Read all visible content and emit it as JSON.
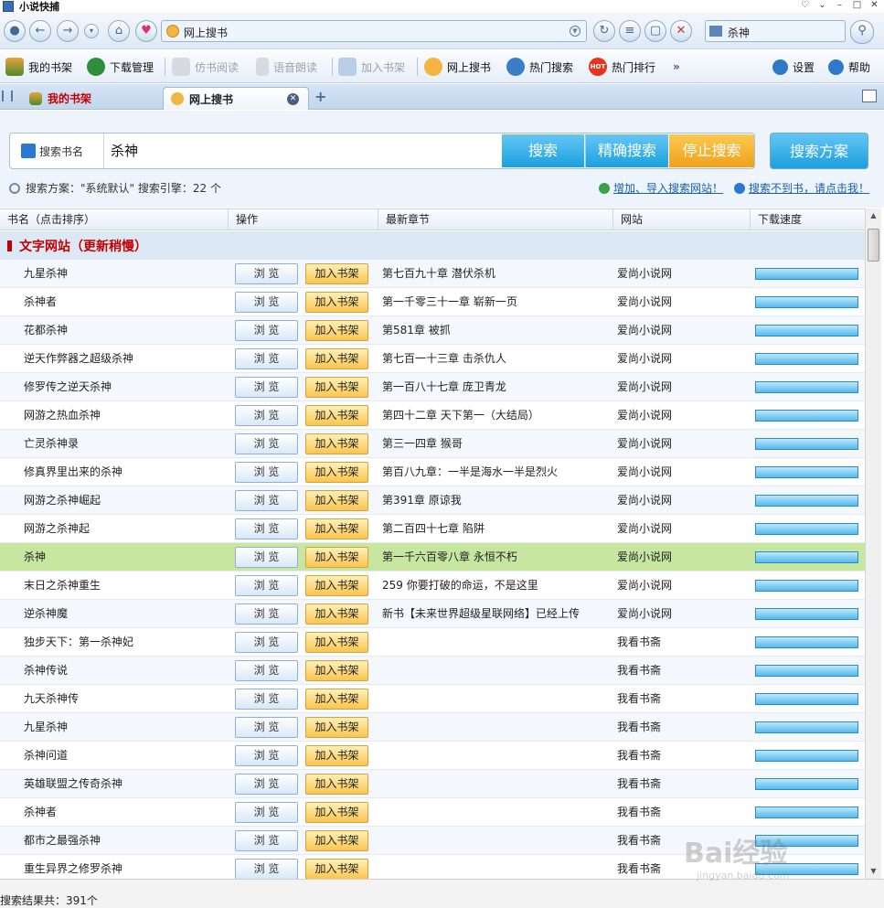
{
  "window": {
    "title": "小说快捕"
  },
  "address": {
    "text": "网上搜书"
  },
  "top_search": {
    "value": "杀神"
  },
  "toolbar": {
    "items": [
      {
        "label": "我的书架",
        "icon": "bookshelf-icon"
      },
      {
        "label": "下载管理",
        "icon": "download-globe-icon"
      },
      {
        "label": "仿书阅读",
        "icon": "book-read-icon",
        "disabled": true
      },
      {
        "label": "语音朗读",
        "icon": "microphone-icon",
        "disabled": true
      },
      {
        "label": "加入书架",
        "icon": "add-shelf-icon",
        "disabled": true
      },
      {
        "label": "网上搜书",
        "icon": "web-search-icon"
      },
      {
        "label": "热门搜索",
        "icon": "hot-search-icon"
      },
      {
        "label": "热门排行",
        "icon": "hot-badge-icon"
      }
    ],
    "settings_label": "设置",
    "help_label": "帮助"
  },
  "tabs": [
    {
      "label": "我的书架"
    },
    {
      "label": "网上搜书"
    }
  ],
  "search": {
    "label": "搜索书名",
    "value": "杀神",
    "btn_search": "搜索",
    "btn_exact": "精确搜索",
    "btn_stop": "停止搜索",
    "btn_scheme": "搜索方案",
    "info": "搜索方案：\"系统默认\"  搜索引擎：22 个",
    "link_add": "增加、导入搜索网站！",
    "link_help": "搜索不到书，请点击我！"
  },
  "table": {
    "headers": [
      "书名（点击排序）",
      "操作",
      "最新章节",
      "网站",
      "下载速度"
    ],
    "group": "文字网站（更新稍慢）",
    "browse_label": "浏 览",
    "add_label": "加入书架",
    "rows": [
      {
        "name": "九星杀神",
        "latest": "第七百九十章 潜伏杀机",
        "site": "爱尚小说网",
        "speed": 1
      },
      {
        "name": "杀神者",
        "latest": "第一千零三十一章 崭新一页",
        "site": "爱尚小说网",
        "speed": 1
      },
      {
        "name": "花都杀神",
        "latest": "第581章 被抓",
        "site": "爱尚小说网",
        "speed": 1
      },
      {
        "name": "逆天作弊器之超级杀神",
        "latest": "第七百一十三章 击杀仇人",
        "site": "爱尚小说网",
        "speed": 1
      },
      {
        "name": "修罗传之逆天杀神",
        "latest": "第一百八十七章 庞卫青龙",
        "site": "爱尚小说网",
        "speed": 1
      },
      {
        "name": "网游之热血杀神",
        "latest": "第四十二章 天下第一（大结局）",
        "site": "爱尚小说网",
        "speed": 1
      },
      {
        "name": "亡灵杀神录",
        "latest": "第三一四章 猴哥",
        "site": "爱尚小说网",
        "speed": 1
      },
      {
        "name": "修真界里出来的杀神",
        "latest": "第百八九章：一半是海水一半是烈火",
        "site": "爱尚小说网",
        "speed": 1
      },
      {
        "name": "网游之杀神崛起",
        "latest": "第391章 原谅我",
        "site": "爱尚小说网",
        "speed": 1
      },
      {
        "name": "网游之杀神起",
        "latest": "第二百四十七章 陷阱",
        "site": "爱尚小说网",
        "speed": 1
      },
      {
        "name": "杀神",
        "latest": "第一千六百零八章 永恒不朽",
        "site": "爱尚小说网",
        "speed": 1,
        "selected": true
      },
      {
        "name": "末日之杀神重生",
        "latest": "259 你要打破的命运，不是这里",
        "site": "爱尚小说网",
        "speed": 1
      },
      {
        "name": "逆杀神魔",
        "latest": "新书【未来世界超级星联网络】已经上传",
        "site": "爱尚小说网",
        "speed": 1
      },
      {
        "name": "独步天下：第一杀神妃",
        "latest": "",
        "site": "我看书斋",
        "speed": 1
      },
      {
        "name": "杀神传说",
        "latest": "",
        "site": "我看书斋",
        "speed": 1
      },
      {
        "name": "九天杀神传",
        "latest": "",
        "site": "我看书斋",
        "speed": 1
      },
      {
        "name": "九星杀神",
        "latest": "",
        "site": "我看书斋",
        "speed": 1
      },
      {
        "name": "杀神问道",
        "latest": "",
        "site": "我看书斋",
        "speed": 1
      },
      {
        "name": "英雄联盟之传奇杀神",
        "latest": "",
        "site": "我看书斋",
        "speed": 1
      },
      {
        "name": "杀神者",
        "latest": "",
        "site": "我看书斋",
        "speed": 1
      },
      {
        "name": "都市之最强杀神",
        "latest": "",
        "site": "我看书斋",
        "speed": 1
      },
      {
        "name": "重生异界之修罗杀神",
        "latest": "",
        "site": "我看书斋",
        "speed": 1
      }
    ]
  },
  "status": {
    "text": "搜索结果共：391个"
  },
  "watermark": {
    "main": "Bai经验",
    "sub": "jingyan.baidu.com"
  }
}
